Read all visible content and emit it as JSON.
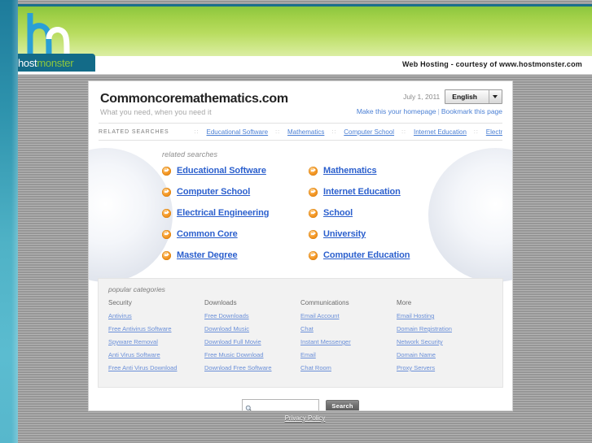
{
  "branding": {
    "logo_host": "host",
    "logo_monster": "monster",
    "courtesy_text": "Web Hosting - courtesy of www.hostmonster.com"
  },
  "header": {
    "site_title": "Commoncoremathematics.com",
    "tagline": "What you need, when you need it",
    "date": "July 1, 2011",
    "language_selected": "English",
    "make_homepage_label": "Make this your homepage",
    "link_separator": "|",
    "bookmark_label": "Bookmark this page"
  },
  "related_searches_bar": {
    "label": "RELATED SEARCHES",
    "dots": "::",
    "items": [
      "Educational Software",
      "Mathematics",
      "Computer School",
      "Internet Education",
      "Electrical Engineering"
    ]
  },
  "related_searches": {
    "title": "related searches",
    "links": [
      "Educational Software",
      "Mathematics",
      "Computer School",
      "Internet Education",
      "Electrical Engineering",
      "School",
      "Common Core",
      "University",
      "Master Degree",
      "Computer Education"
    ]
  },
  "popular_categories": {
    "title": "popular categories",
    "columns": [
      {
        "heading": "Security",
        "links": [
          "Antivirus",
          "Free Antivirus Software",
          "Spyware Removal",
          "Anti Virus Software",
          "Free Anti Virus Download"
        ]
      },
      {
        "heading": "Downloads",
        "links": [
          "Free Downloads",
          "Download Music",
          "Download Full Movie",
          "Free Music Download",
          "Download Free Software"
        ]
      },
      {
        "heading": "Communications",
        "links": [
          "Email Account",
          "Chat",
          "Instant Messenger",
          "Email",
          "Chat Room"
        ]
      },
      {
        "heading": "More",
        "links": [
          "Email Hosting",
          "Domain Registration",
          "Network Security",
          "Domain Name",
          "Proxy Servers"
        ]
      }
    ]
  },
  "search": {
    "value": "",
    "placeholder": "",
    "button_label": "Search",
    "icon": "magnifier-icon"
  },
  "footer": {
    "privacy_policy": "Privacy Policy"
  },
  "colors": {
    "green_band": "#a3d149",
    "teal_logo": "#136b88",
    "link_blue": "#2b5fcd",
    "bullet_orange": "#f59a28",
    "page_bg_gray": "#9e9e9e"
  }
}
